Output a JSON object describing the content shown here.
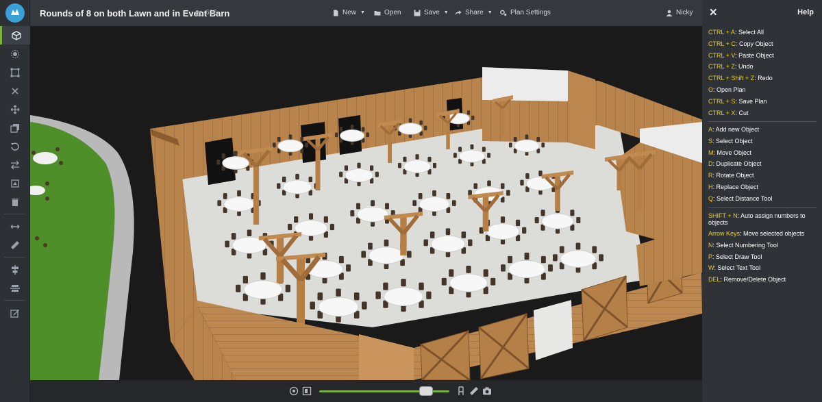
{
  "app": {
    "title": "Rounds of 8 on both Lawn and in Event Barn",
    "guest_count": "616",
    "user": "Nicky"
  },
  "menu": {
    "new": "New",
    "open": "Open",
    "save": "Save",
    "share": "Share",
    "plan_settings": "Plan Settings"
  },
  "toolbar": {
    "icons": [
      "3d-view-icon",
      "objects-icon",
      "select-icon",
      "delete-cross-icon",
      "move-icon",
      "duplicate-icon",
      "rotate-icon",
      "replace-icon",
      "crop-icon",
      "trash-icon",
      "distance-icon",
      "measure-icon",
      "align-icon",
      "distribute-icon",
      "edit-icon"
    ]
  },
  "help": {
    "title": "Help",
    "group1": [
      {
        "key": "CTRL + A",
        "desc": "Select All"
      },
      {
        "key": "CTRL + C",
        "desc": "Copy Object"
      },
      {
        "key": "CTRL + V",
        "desc": "Paste Object"
      },
      {
        "key": "CTRL + Z",
        "desc": "Undo"
      },
      {
        "key": "CTRL + Shift + Z",
        "desc": "Redo"
      },
      {
        "key": "O",
        "desc": "Open Plan"
      },
      {
        "key": "CTRL + S",
        "desc": "Save Plan"
      },
      {
        "key": "CTRL + X",
        "desc": "Cut"
      }
    ],
    "group2": [
      {
        "key": "A",
        "desc": "Add new Object"
      },
      {
        "key": "S",
        "desc": "Select Object"
      },
      {
        "key": "M",
        "desc": "Move Object"
      },
      {
        "key": "D",
        "desc": "Duplicate Object"
      },
      {
        "key": "R",
        "desc": "Rotate Object"
      },
      {
        "key": "H",
        "desc": "Replace Object"
      },
      {
        "key": "Q",
        "desc": "Select Distance Tool"
      }
    ],
    "group3": [
      {
        "key": "SHIFT + N",
        "desc": "Auto assign numbers to objects"
      },
      {
        "key": "Arrow Keys",
        "desc": "Move selected objects"
      },
      {
        "key": "N",
        "desc": "Select Numbering Tool"
      },
      {
        "key": "P",
        "desc": "Select Draw Tool"
      },
      {
        "key": "W",
        "desc": "Select Text Tool"
      },
      {
        "key": "DEL",
        "desc": "Remove/Delete Object"
      }
    ]
  },
  "viewer": {
    "zoom_level": 0.82
  },
  "colors": {
    "accent": "#7bb241",
    "shortcut_key": "#f2d21a",
    "wood": "#b8834c",
    "grass": "#4f8f2a",
    "floor": "#d9d9d6"
  }
}
